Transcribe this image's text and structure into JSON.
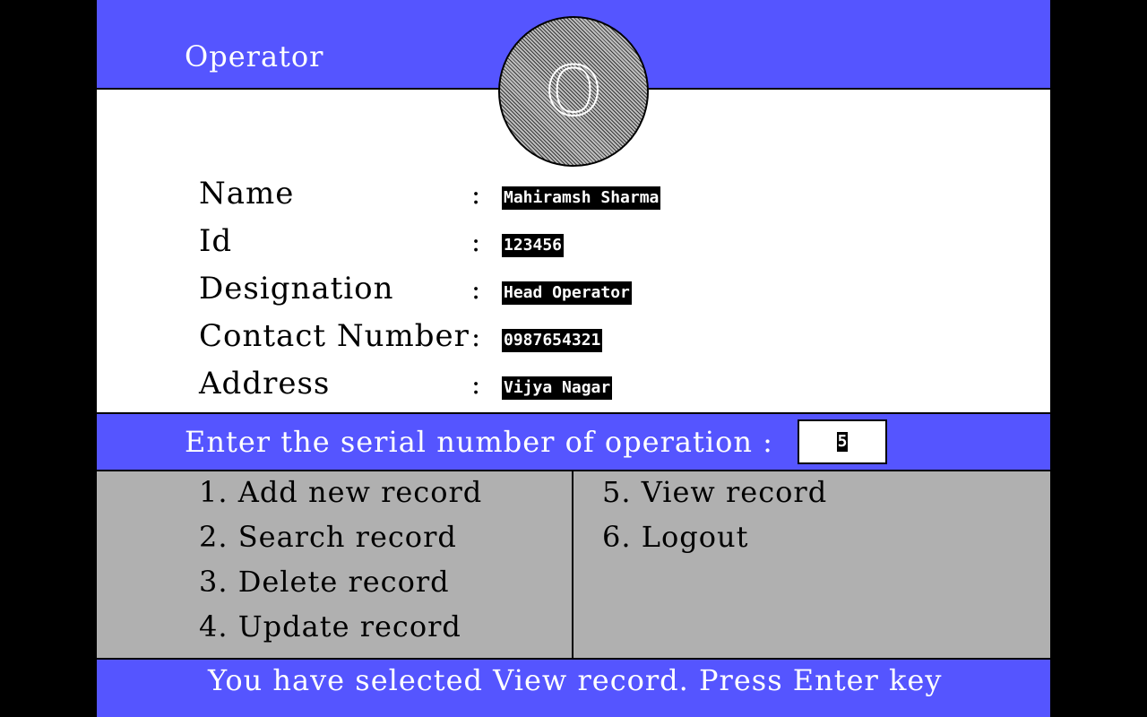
{
  "header": {
    "title": "Operator",
    "avatar_letter": "O"
  },
  "profile": {
    "fields": [
      {
        "label": "Name",
        "value": "Mahiramsh Sharma"
      },
      {
        "label": "Id",
        "value": "123456"
      },
      {
        "label": "Designation",
        "value": "Head Operator"
      },
      {
        "label": "Contact Number",
        "value": "0987654321"
      },
      {
        "label": "Address",
        "value": "Vijya Nagar"
      }
    ],
    "separator": ":"
  },
  "prompt": {
    "text": "Enter the serial number of operation :",
    "input_value": "5"
  },
  "menu": {
    "items": [
      "1. Add new record",
      "2. Search record",
      "3. Delete record",
      "4. Update record",
      "5. View record",
      "6. Logout"
    ]
  },
  "status": {
    "message": "You have selected View record. Press Enter key"
  },
  "colors": {
    "accent": "#5555ff",
    "menu_bg": "#b0b0b0",
    "outer_bg": "#000000"
  }
}
